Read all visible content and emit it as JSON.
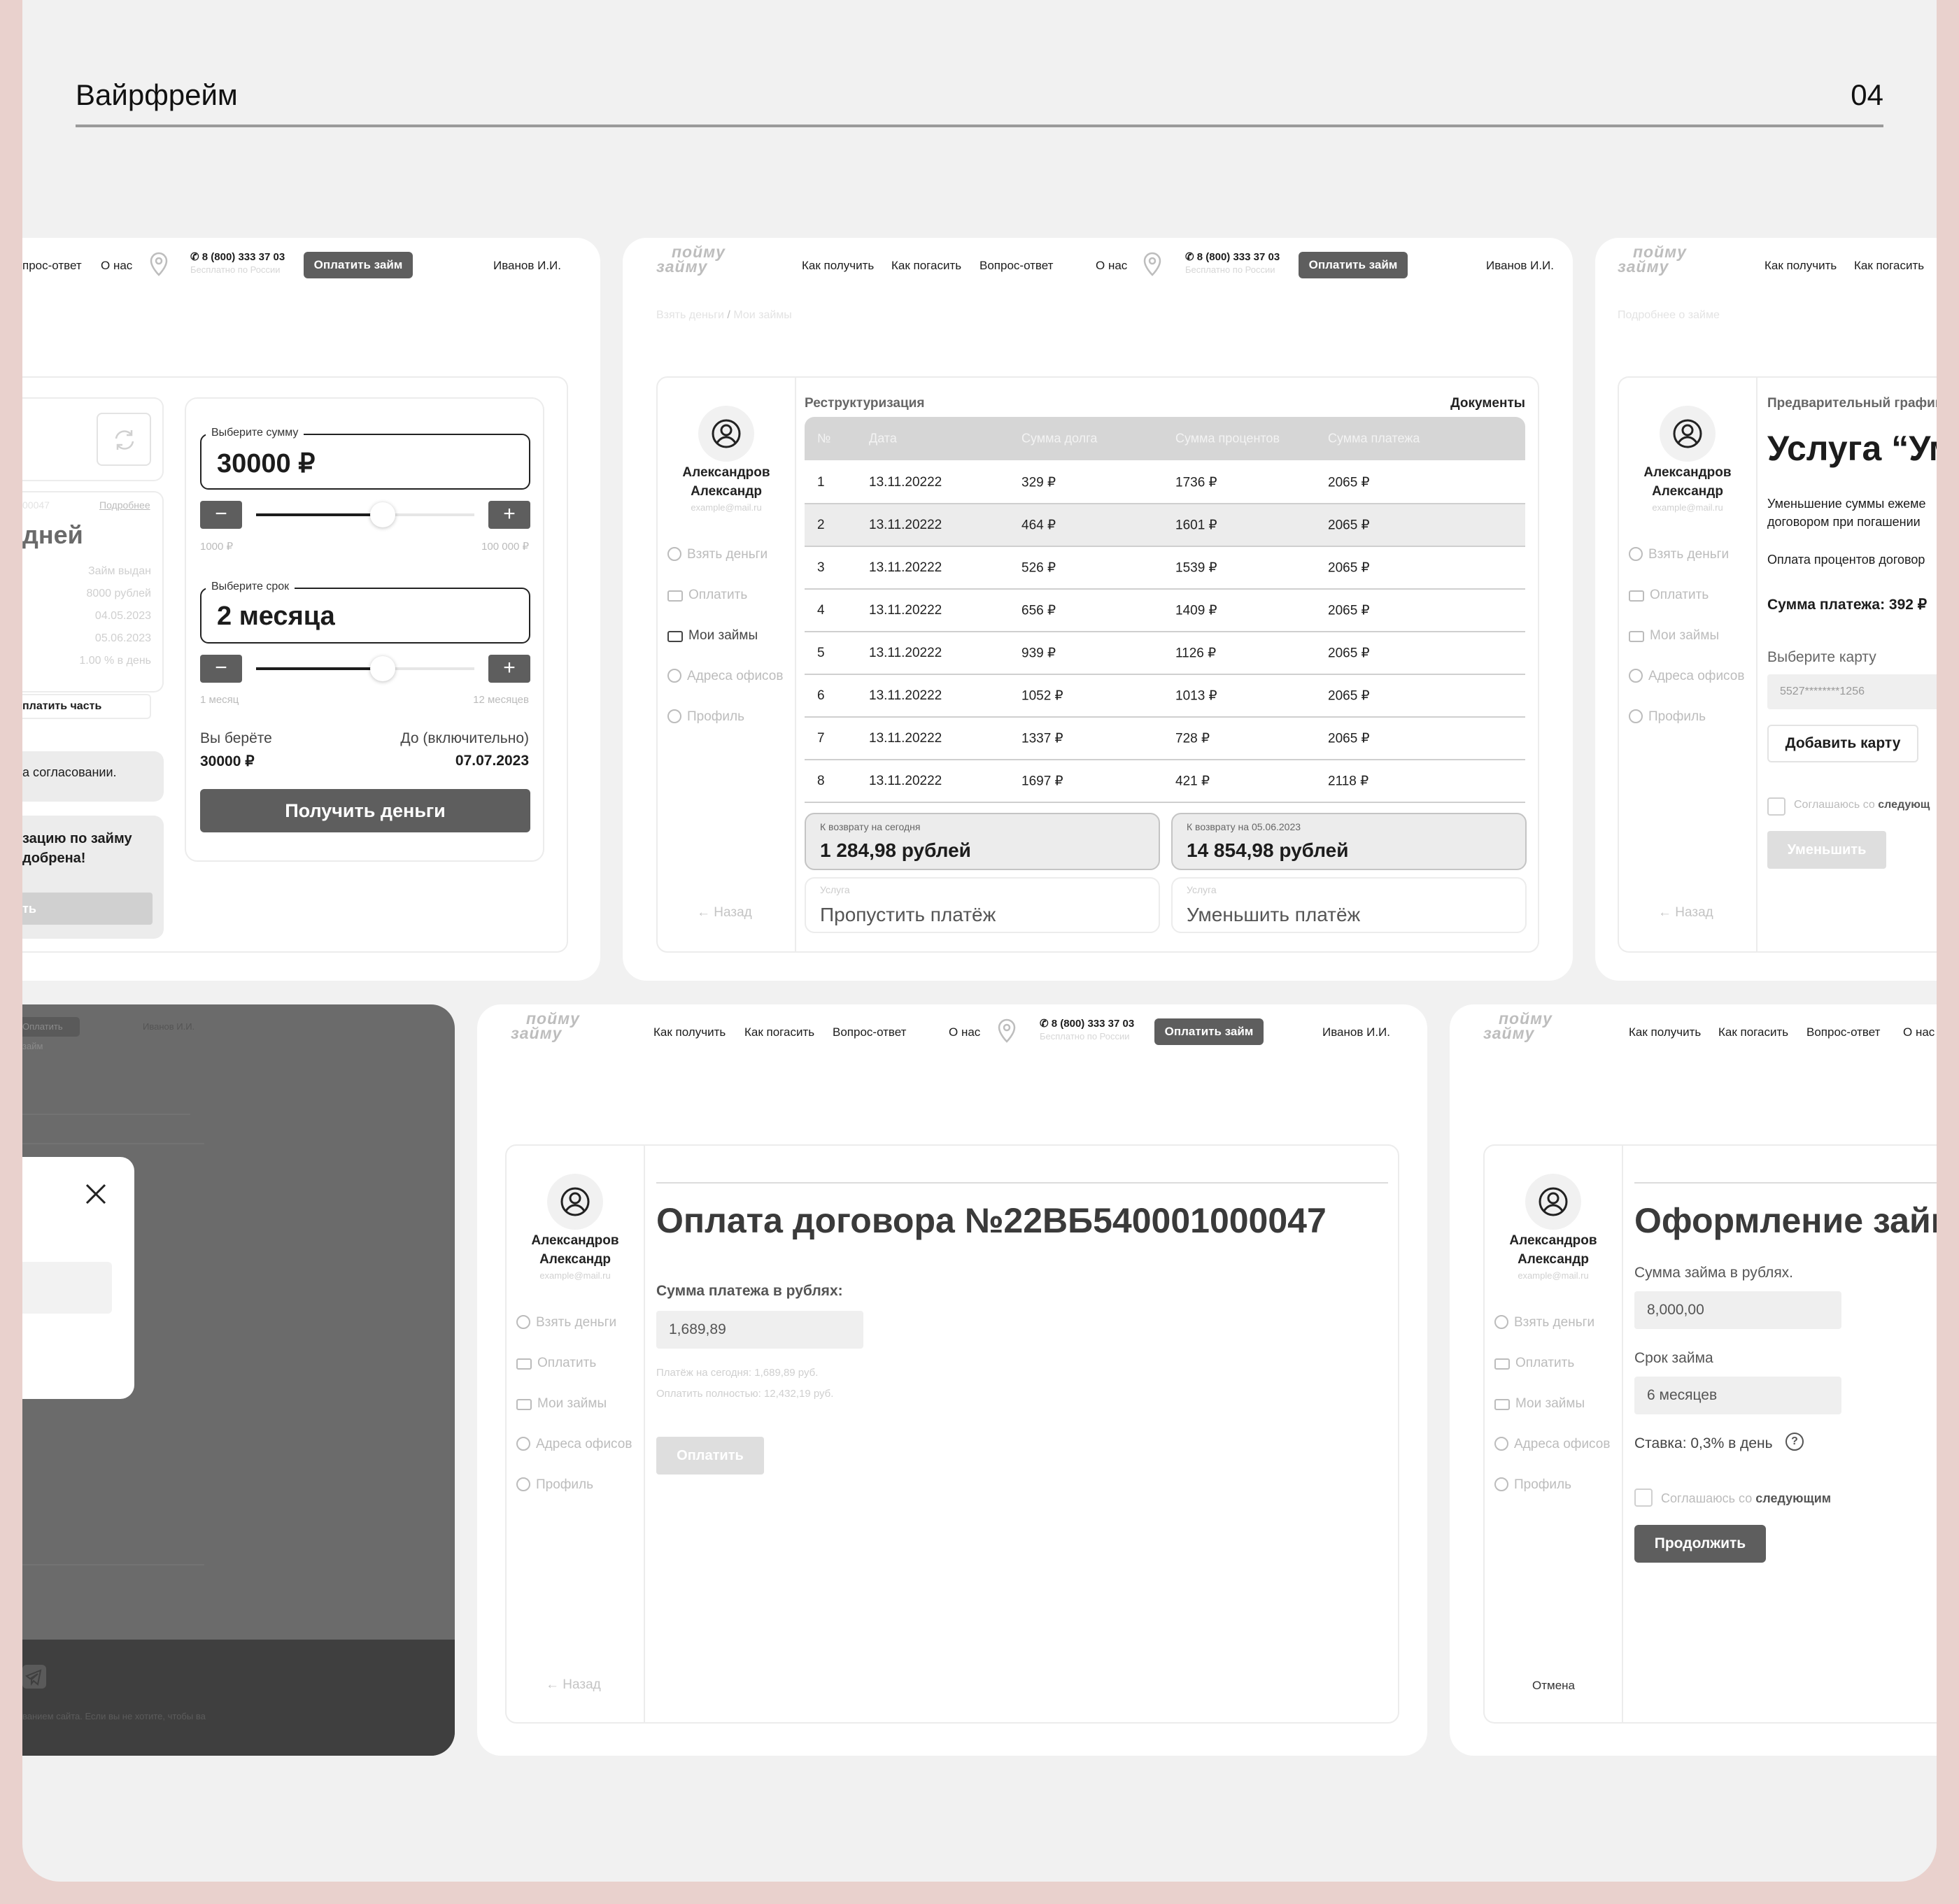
{
  "sheet": {
    "title": "Вайрфрейм",
    "number": "04"
  },
  "nav": {
    "how_get": "Как получить",
    "how_pay": "Как погасить",
    "faq": "Вопрос-ответ",
    "faq_cut": "прос-ответ",
    "about": "О нас",
    "phone": "8 (800) 333 37 03",
    "phone_sub": "Бесплатно по России",
    "pay_loan": "Оплатить займ",
    "user": "Иванов И.И.",
    "logo_top": "пойму",
    "logo_bottom": "займу"
  },
  "sidebar": {
    "name_line1": "Александров",
    "name_line2": "Александр",
    "email": "example@mail.ru",
    "items": [
      "Взять деньги",
      "Оплатить",
      "Мои займы",
      "Адреса офисов",
      "Профиль"
    ],
    "back": "Назад",
    "cancel": "Отмена"
  },
  "calc": {
    "days_label": "дней",
    "more_link": "Подробнее",
    "code_partial": "00047",
    "loan_issued": "Займ выдан",
    "amount": "8000 рублей",
    "date1": "04.05.2023",
    "date2": "05.06.2023",
    "rate": "1.00 % в день",
    "pay_part": "платить часть",
    "approval": "а согласовании.",
    "restr_line1": "зацию по займу",
    "restr_line2": "добрена!",
    "restr_btn": "ть",
    "sum_label": "Выберите сумму",
    "sum_value": "30000 ₽",
    "sum_min": "1000 ₽",
    "sum_max": "100 000 ₽",
    "sum_fill": 0.58,
    "term_label": "Выберите срок",
    "term_value": "2 месяца",
    "term_min": "1 месяц",
    "term_max": "12 месяцев",
    "term_fill": 0.58,
    "you_take": "Вы берёте",
    "you_take_val": "30000 ₽",
    "until": "До (включительно)",
    "until_val": "07.07.2023",
    "get_money": "Получить деньги",
    "minus": "−",
    "plus": "+"
  },
  "restr": {
    "crumb1": "Взять деньги",
    "crumb_sep": "/",
    "crumb2": "Мои займы",
    "title": "Реструктуризация",
    "docs": "Документы",
    "headers": [
      "№",
      "Дата",
      "Сумма долга",
      "Сумма процентов",
      "Сумма платежа"
    ],
    "rows": [
      [
        "1",
        "13.11.20222",
        "329  ₽",
        "1736  ₽",
        "2065  ₽"
      ],
      [
        "2",
        "13.11.20222",
        "464  ₽",
        "1601  ₽",
        "2065  ₽"
      ],
      [
        "3",
        "13.11.20222",
        "526  ₽",
        "1539 ₽",
        "2065  ₽"
      ],
      [
        "4",
        "13.11.20222",
        "656  ₽",
        "1409  ₽",
        "2065 ₽"
      ],
      [
        "5",
        "13.11.20222",
        "939  ₽",
        "1126  ₽",
        "2065  ₽"
      ],
      [
        "6",
        "13.11.20222",
        "1052  ₽",
        "1013  ₽",
        "2065  ₽"
      ],
      [
        "7",
        "13.11.20222",
        "1337  ₽",
        "728  ₽",
        "2065 ₽"
      ],
      [
        "8",
        "13.11.20222",
        "1697  ₽",
        "421  ₽",
        "2118 ₽"
      ]
    ],
    "today_label": "К возврату на сегодня",
    "today_value": "1 284,98 рублей",
    "date_label": "К возврату на 05.06.2023",
    "date_value": "14 854,98 рублей",
    "svc_label": "Услуга",
    "svc1": "Пропустить платёж",
    "svc2": "Уменьшить платёж"
  },
  "service": {
    "crumb": "Подробнее о займе",
    "schedule": "Предварительный график",
    "title": "Услуга “Ум",
    "desc1": "Уменьшение суммы ежеме",
    "desc2": "договором при погашении",
    "interest": "Оплата процентов договор",
    "pay_sum": "Сумма платежа: 392 ₽",
    "choose_card": "Выберите карту",
    "card": "5527********1256",
    "add_card": "Добавить карту",
    "agree": "Соглашаюсь со",
    "agree_bold": "следующ",
    "reduce": "Уменьшить"
  },
  "modal": {
    "pay_loan": "Оплатить займ",
    "user": "Иванов И.И.",
    "footer": "ванием сайта. Если вы не хотите, чтобы ва"
  },
  "payment": {
    "title": "Оплата договора №22ВБ540001000047",
    "sum_label": "Сумма платежа в рублях:",
    "sum_value": "1,689,89",
    "today": "Платёж на сегодня: 1,689,89 руб.",
    "full": "Оплатить полностью: 12,432,19 руб.",
    "pay_btn": "Оплатить"
  },
  "apply": {
    "title": "Оформление займа",
    "sum_label": "Сумма займа в рублях.",
    "sum_value": "8,000,00",
    "term_label": "Срок займа",
    "term_value": "6 месяцев",
    "rate": "Ставка: 0,3% в день",
    "agree": "Соглашаюсь со",
    "agree_bold": "следующим",
    "continue": "Продолжить"
  }
}
